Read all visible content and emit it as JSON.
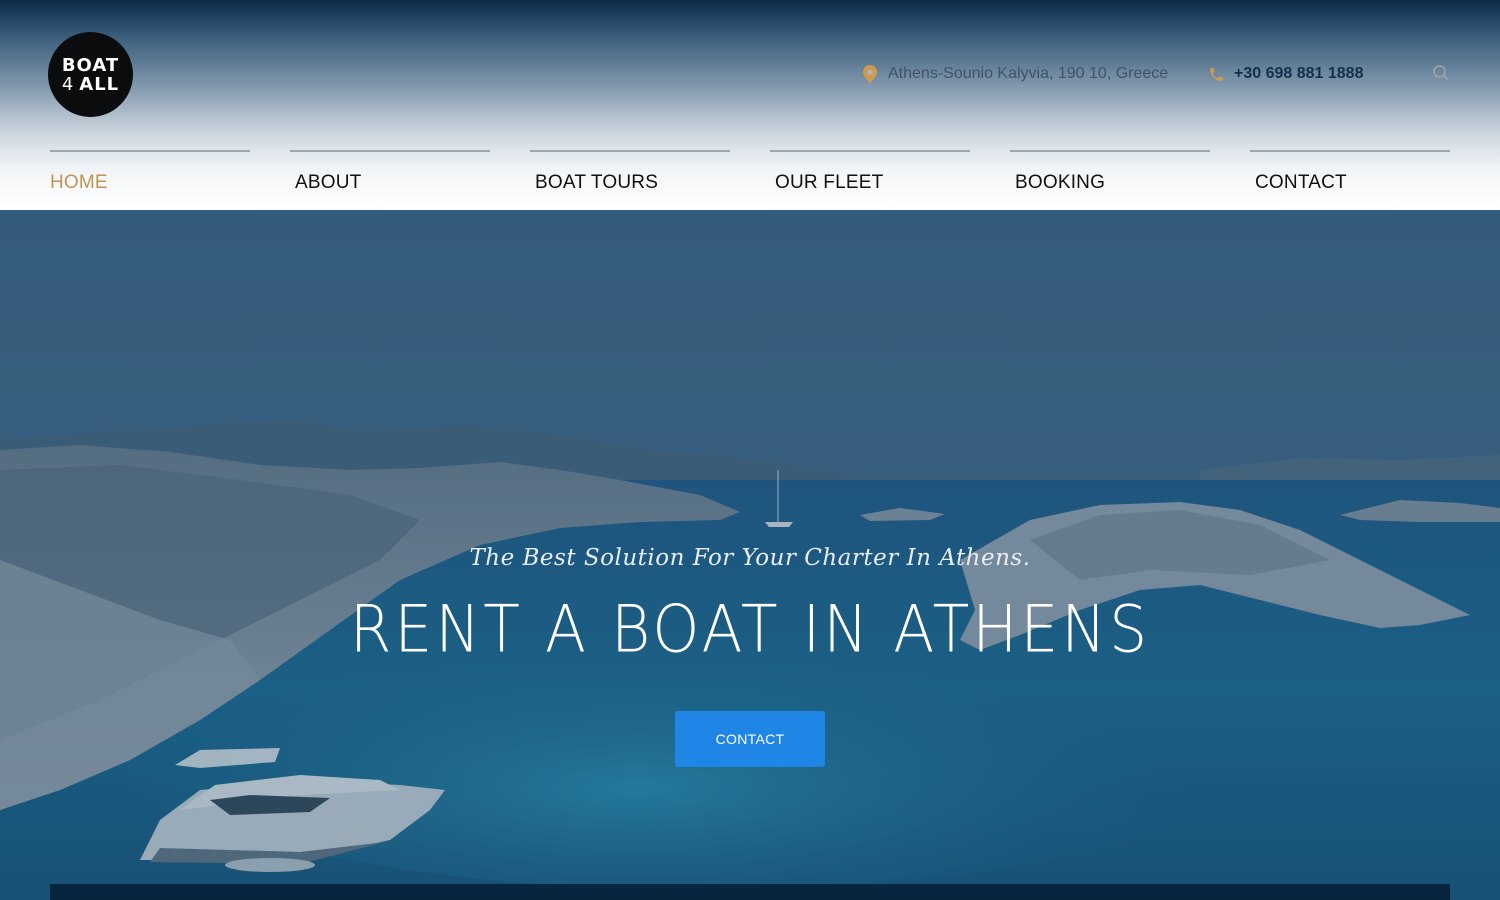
{
  "header": {
    "logo_line1": "BOAT",
    "logo_line2_num": "4",
    "logo_line2_word": "ALL",
    "address": "Athens-Sounio Kalyvia, 190 10, Greece",
    "phone": "+30 698 881 1888",
    "icons": {
      "address": "map-pin-icon",
      "phone": "phone-icon",
      "search": "search-icon"
    }
  },
  "nav": {
    "items": [
      {
        "label": "HOME",
        "active": true
      },
      {
        "label": "ABOUT"
      },
      {
        "label": "BOAT TOURS"
      },
      {
        "label": "OUR FLEET"
      },
      {
        "label": "BOOKING"
      },
      {
        "label": "CONTACT"
      }
    ]
  },
  "hero": {
    "tagline": "The Best Solution For Your Charter In Athens.",
    "headline": "RENT A BOAT IN ATHENS",
    "cta_label": "CONTACT"
  },
  "colors": {
    "accent_gold": "#c09553",
    "cta_blue": "#1f86e6",
    "navy": "#082540"
  }
}
